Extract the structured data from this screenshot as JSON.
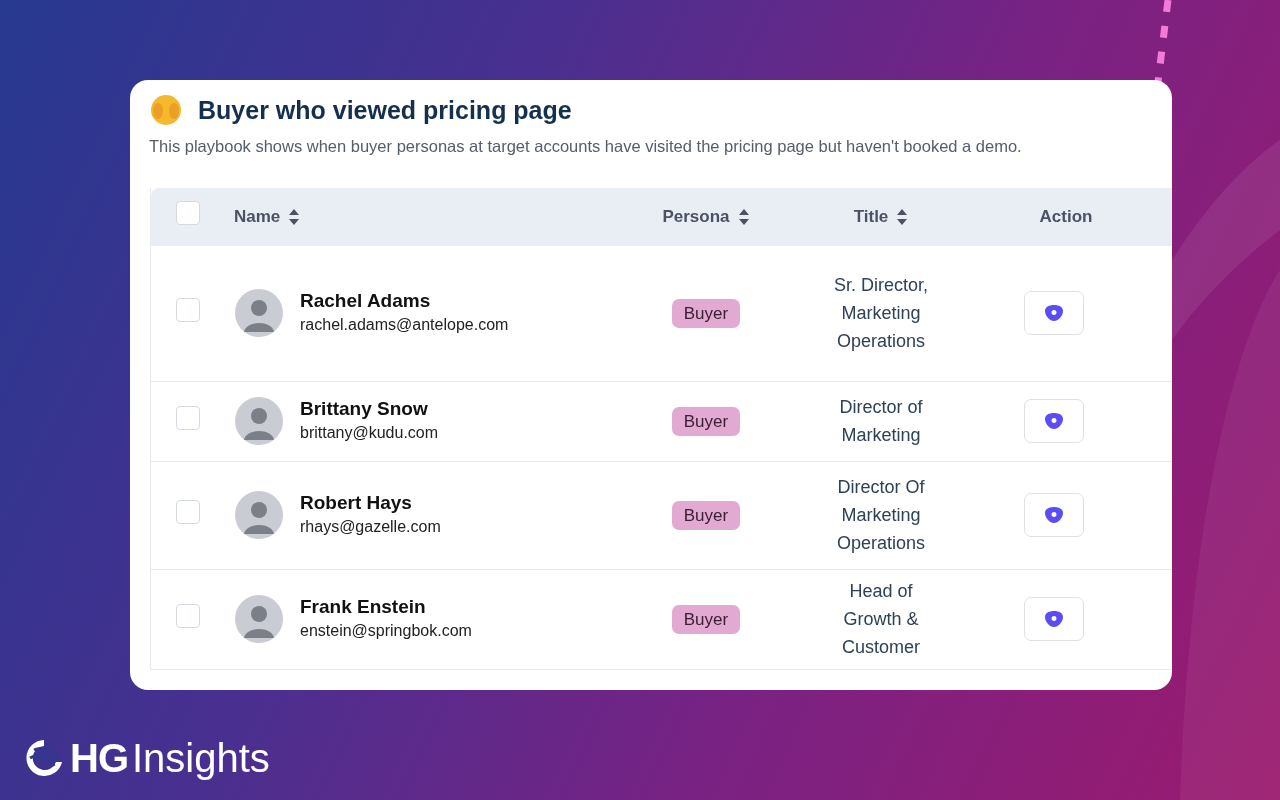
{
  "card": {
    "title": "Buyer who viewed pricing page",
    "description": "This playbook shows when buyer personas at target accounts have visited the pricing page but haven't booked a demo."
  },
  "table": {
    "select_all": {
      "checked": false
    },
    "columns": [
      {
        "label": "Name",
        "sortable": true
      },
      {
        "label": "Persona",
        "sortable": true
      },
      {
        "label": "Title",
        "sortable": true
      },
      {
        "label": "Action",
        "sortable": false
      }
    ],
    "rows": [
      {
        "checked": false,
        "name": "Rachel Adams",
        "email": "rachel.adams@antelope.com",
        "persona": "Buyer",
        "title": "Sr. Director, Marketing Operations"
      },
      {
        "checked": false,
        "name": "Brittany Snow",
        "email": "brittany@kudu.com",
        "persona": "Buyer",
        "title": "Director of Marketing"
      },
      {
        "checked": false,
        "name": "Robert Hays",
        "email": "rhays@gazelle.com",
        "persona": "Buyer",
        "title": "Director Of Marketing Operations"
      },
      {
        "checked": false,
        "name": "Frank Enstein",
        "email": "enstein@springbok.com",
        "persona": "Buyer",
        "title": "Head of Growth & Customer"
      }
    ]
  },
  "logo": {
    "mark": "HG",
    "word": "Insights"
  }
}
